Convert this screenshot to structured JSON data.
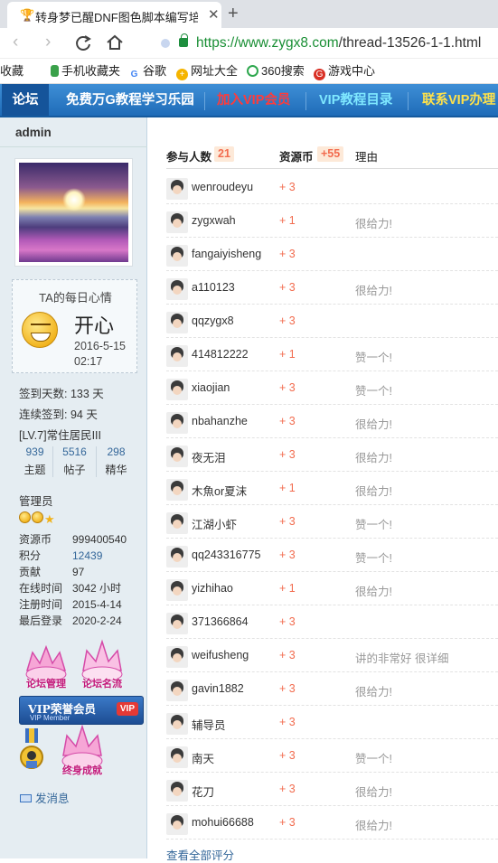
{
  "browser": {
    "tab_title": "转身梦已醒DNF图色脚本编写培训",
    "close_glyph": "✕",
    "newtab_glyph": "+",
    "url_host": "https://www.zygx8.com",
    "url_path": "/thread-13526-1-1.html"
  },
  "bookmarks": [
    {
      "label": "收藏",
      "icon": "star-icon",
      "color": "#f0a30a"
    },
    {
      "label": "手机收藏夹",
      "icon": "phone-icon",
      "color": "#3aa14a"
    },
    {
      "label": "谷歌",
      "icon": "google-icon",
      "color": "#4285f4"
    },
    {
      "label": "网址大全",
      "icon": "globe-icon",
      "color": "#f5b400"
    },
    {
      "label": "360搜索",
      "icon": "360-icon",
      "color": "#2fa84f"
    },
    {
      "label": "游戏中心",
      "icon": "game-icon",
      "color": "#d93025"
    }
  ],
  "forum_nav": {
    "home": "论坛",
    "items": [
      {
        "label": "免费万G教程学习乐园",
        "color": "#ffffff"
      },
      {
        "label": "加入VIP会员",
        "color": "#ff3b3b"
      },
      {
        "label": "VIP教程目录",
        "color": "#7fe8ff"
      },
      {
        "label": "联系VIP办理",
        "color": "#ffe14a"
      }
    ]
  },
  "profile": {
    "username": "admin",
    "mood_title": "TA的每日心情",
    "mood": "开心",
    "mood_date": "2016-5-15",
    "mood_time": "02:17",
    "signin_days": "签到天数: 133 天",
    "streak_days": "连续签到: 94 天",
    "level": "[LV.7]常住居民III",
    "stats": [
      {
        "value": "939",
        "label": "主题"
      },
      {
        "value": "5516",
        "label": "帖子"
      },
      {
        "value": "298",
        "label": "精华"
      }
    ],
    "role": "管理员",
    "info": [
      {
        "key": "资源币",
        "value": "999400540",
        "link": false
      },
      {
        "key": "积分",
        "value": "12439",
        "link": true
      },
      {
        "key": "贡献",
        "value": "97",
        "link": false
      },
      {
        "key": "在线时间",
        "value": "3042 小时",
        "link": false
      },
      {
        "key": "注册时间",
        "value": "2015-4-14",
        "link": false
      },
      {
        "key": "最后登录",
        "value": "2020-2-24",
        "link": false
      }
    ],
    "medal_texts": {
      "m1": "论坛管理",
      "m2": "论坛名流",
      "vip_main": "VIP荣誉会员",
      "vip_sub": "VIP Member",
      "vip_tag": "VIP",
      "m4": "终身成就"
    },
    "send_message": "发消息"
  },
  "rating": {
    "col_participants": "参与人数",
    "participants_count": "21",
    "col_coins": "资源币",
    "coins_total": "+55",
    "col_reason": "理由",
    "rows": [
      {
        "name": "wenroudeyu",
        "score": "+ 3",
        "reason": ""
      },
      {
        "name": "zygxwah",
        "score": "+ 1",
        "reason": "很给力!"
      },
      {
        "name": "fangaiyisheng",
        "score": "+ 3",
        "reason": ""
      },
      {
        "name": "a110123",
        "score": "+ 3",
        "reason": "很给力!"
      },
      {
        "name": "qqzygx8",
        "score": "+ 3",
        "reason": ""
      },
      {
        "name": "414812222",
        "score": "+ 1",
        "reason": "赞一个!"
      },
      {
        "name": "xiaojian",
        "score": "+ 3",
        "reason": "赞一个!"
      },
      {
        "name": "nbahanzhe",
        "score": "+ 3",
        "reason": "很给力!"
      },
      {
        "name": "夜无泪",
        "score": "+ 3",
        "reason": "很给力!"
      },
      {
        "name": "木魚or夏沫",
        "score": "+ 1",
        "reason": "很给力!"
      },
      {
        "name": "江湖小虾",
        "score": "+ 3",
        "reason": "赞一个!"
      },
      {
        "name": "qq243316775",
        "score": "+ 3",
        "reason": "赞一个!"
      },
      {
        "name": "yizhihao",
        "score": "+ 1",
        "reason": "很给力!"
      },
      {
        "name": "371366864",
        "score": "+ 3",
        "reason": ""
      },
      {
        "name": "weifusheng",
        "score": "+ 3",
        "reason": "讲的非常好 很详细"
      },
      {
        "name": "gavin1882",
        "score": "+ 3",
        "reason": "很给力!"
      },
      {
        "name": "辅导员",
        "score": "+ 3",
        "reason": ""
      },
      {
        "name": "南天",
        "score": "+ 3",
        "reason": "赞一个!"
      },
      {
        "name": "花刀",
        "score": "+ 3",
        "reason": "很给力!"
      },
      {
        "name": "mohui66688",
        "score": "+ 3",
        "reason": "很给力!"
      }
    ],
    "view_all": "查看全部评分"
  }
}
